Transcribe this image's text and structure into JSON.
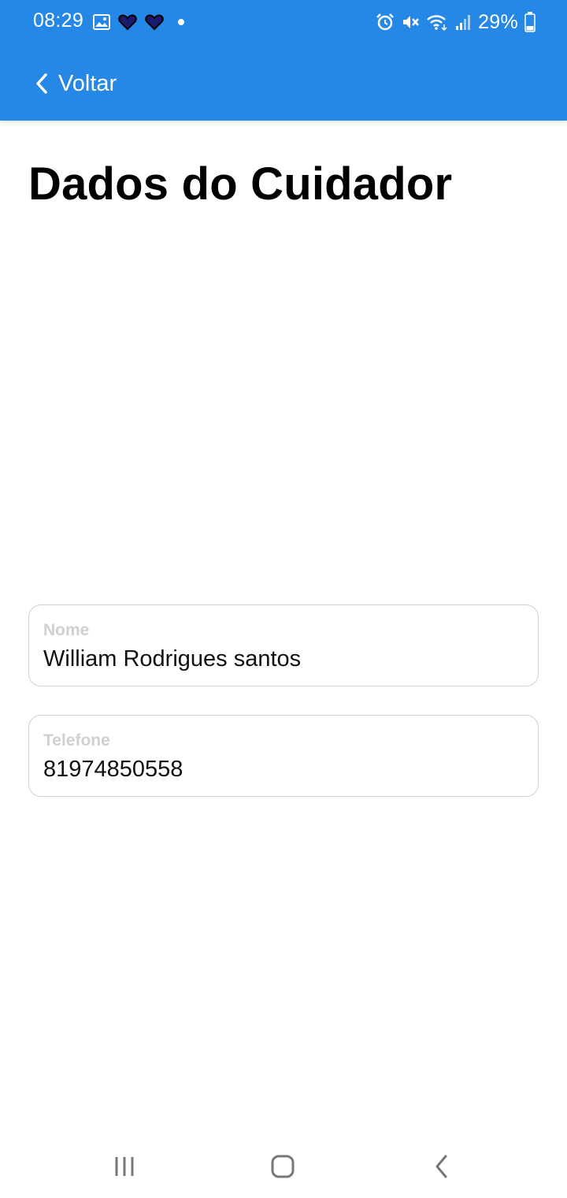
{
  "status_bar": {
    "time": "08:29",
    "battery_percent": "29%",
    "left_icons": [
      "gallery-icon",
      "heart-icon",
      "heart-icon",
      "dot-icon"
    ],
    "right_icons": [
      "alarm-icon",
      "mute-icon",
      "wifi-icon",
      "signal-icon",
      "battery-icon"
    ]
  },
  "header": {
    "back_label": "Voltar",
    "background_color": "#2587E6"
  },
  "page": {
    "title": "Dados do Cuidador"
  },
  "form": {
    "fields": [
      {
        "label": "Nome",
        "value": "William Rodrigues santos"
      },
      {
        "label": "Telefone",
        "value": "81974850558"
      }
    ]
  },
  "nav_bar": {
    "buttons": [
      "recent-apps-icon",
      "home-icon",
      "back-icon"
    ]
  }
}
